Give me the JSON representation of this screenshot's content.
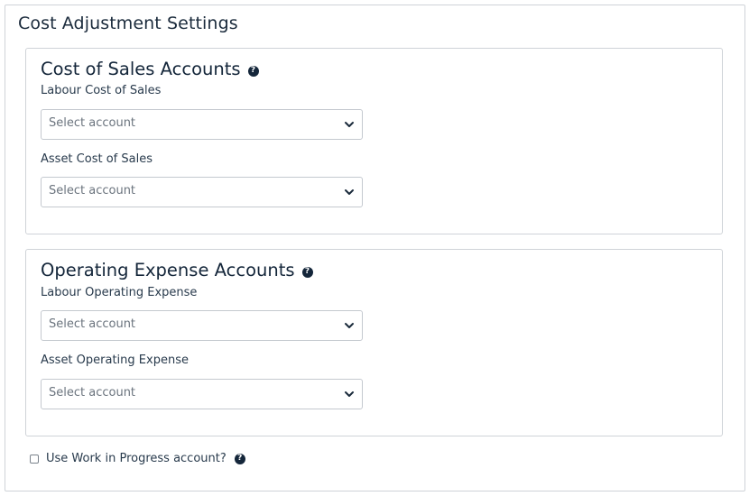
{
  "page": {
    "title": "Cost Adjustment Settings"
  },
  "cost_of_sales": {
    "title": "Cost of Sales Accounts",
    "help_icon": "question-circle-icon",
    "fields": [
      {
        "label": "Labour Cost of Sales",
        "placeholder": "Select account"
      },
      {
        "label": "Asset Cost of Sales",
        "placeholder": "Select account"
      }
    ]
  },
  "operating_expense": {
    "title": "Operating Expense Accounts",
    "help_icon": "question-circle-icon",
    "fields": [
      {
        "label": "Labour Operating Expense",
        "placeholder": "Select account"
      },
      {
        "label": "Asset Operating Expense",
        "placeholder": "Select account"
      }
    ]
  },
  "wip": {
    "label": "Use Work in Progress account?",
    "checked": false,
    "help_icon": "question-circle-icon"
  },
  "colors": {
    "text_dark": "#14263a",
    "border": "#cfd3d8",
    "placeholder": "#6b747e"
  }
}
